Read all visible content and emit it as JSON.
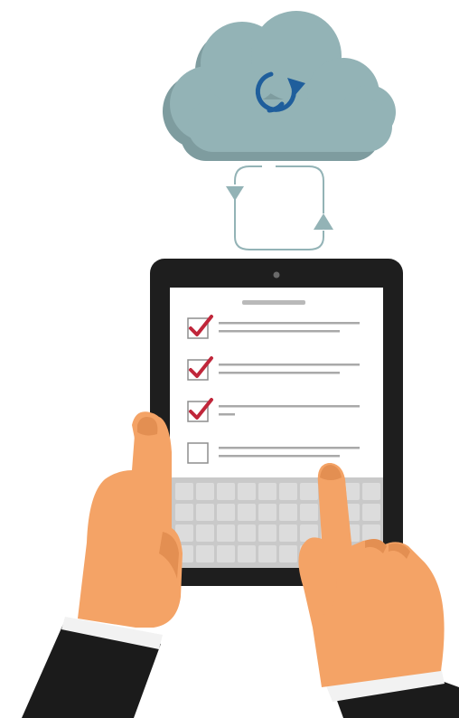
{
  "illustration": {
    "cloud": {
      "icon": "sync-icon",
      "color": "#93B3B6",
      "shadow_color": "#7E9C9F",
      "icon_color": "#1F5E9C"
    },
    "sync_loop": {
      "icon": "sync-arrows-icon",
      "color": "#93B3B6"
    },
    "tablet": {
      "bezel_color": "#1E1E1E",
      "screen_color": "#FFFFFF",
      "camera_color": "#6A6A6A",
      "header_bar_color": "#B9B9B9",
      "line_color": "#A9A9A9"
    },
    "checklist": {
      "check_color": "#C0263A",
      "box_color": "#8E8E8E",
      "items": [
        {
          "checked": true,
          "lines": 2
        },
        {
          "checked": true,
          "lines": 2
        },
        {
          "checked": true,
          "lines": 1
        },
        {
          "checked": false,
          "lines": 2
        }
      ]
    },
    "keyboard": {
      "rows": 4,
      "keys_per_row": 10,
      "key_color": "#DCDCDC",
      "background_color": "#C9C9C9"
    },
    "hands": {
      "skin_color": "#F4A366",
      "skin_shadow_color": "#E38F52",
      "sleeve_color": "#1B1B1B",
      "cuff_color": "#F2F2F2"
    }
  }
}
